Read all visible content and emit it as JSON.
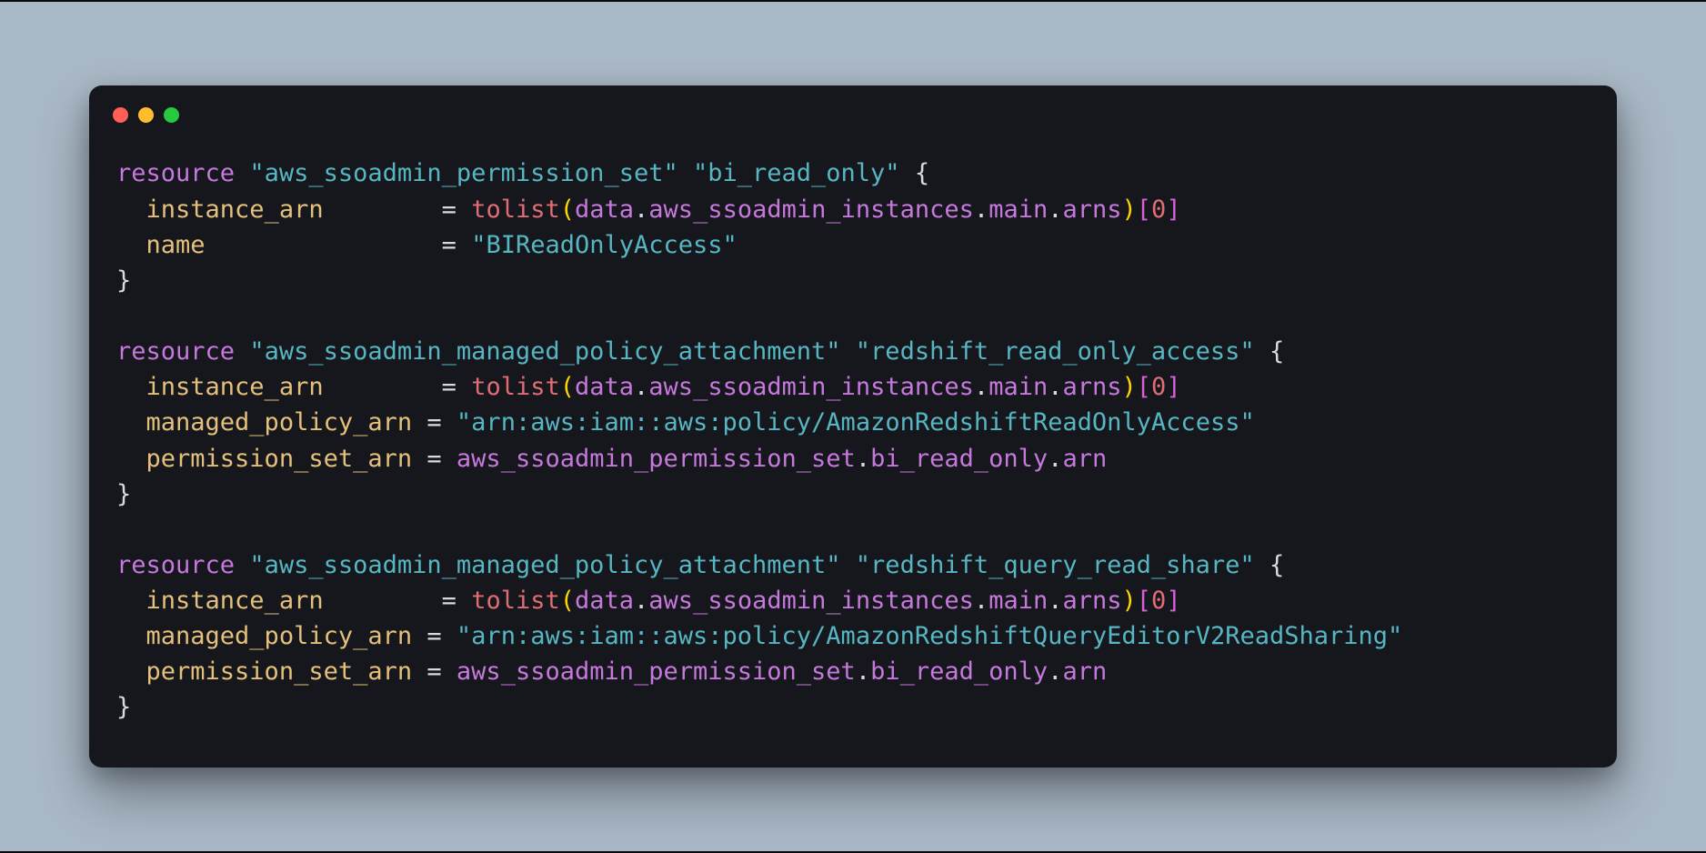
{
  "traffic_lights": {
    "red": "#ff5f56",
    "yellow": "#ffbd2e",
    "green": "#27c93f"
  },
  "code": {
    "block1": {
      "kw": "resource",
      "type": "\"aws_ssoadmin_permission_set\"",
      "name": "\"bi_read_only\"",
      "instance_arn_key": "instance_arn",
      "instance_arn_pad": "       ",
      "tolist": "tolist",
      "ref_data": "data",
      "ref_mod": "aws_ssoadmin_instances",
      "ref_inst": "main",
      "ref_attr": "arns",
      "idx": "0",
      "name_key": "name",
      "name_pad": "               ",
      "name_val": "\"BIReadOnlyAccess\""
    },
    "block2": {
      "kw": "resource",
      "type": "\"aws_ssoadmin_managed_policy_attachment\"",
      "name": "\"redshift_read_only_access\"",
      "instance_arn_key": "instance_arn",
      "instance_arn_pad": "       ",
      "tolist": "tolist",
      "ref_data": "data",
      "ref_mod": "aws_ssoadmin_instances",
      "ref_inst": "main",
      "ref_attr": "arns",
      "idx": "0",
      "managed_key": "managed_policy_arn",
      "managed_val": "\"arn:aws:iam::aws:policy/AmazonRedshiftReadOnlyAccess\"",
      "perm_key": "permission_set_arn",
      "perm_ref_a": "aws_ssoadmin_permission_set",
      "perm_ref_b": "bi_read_only",
      "perm_ref_c": "arn"
    },
    "block3": {
      "kw": "resource",
      "type": "\"aws_ssoadmin_managed_policy_attachment\"",
      "name": "\"redshift_query_read_share\"",
      "instance_arn_key": "instance_arn",
      "instance_arn_pad": "       ",
      "tolist": "tolist",
      "ref_data": "data",
      "ref_mod": "aws_ssoadmin_instances",
      "ref_inst": "main",
      "ref_attr": "arns",
      "idx": "0",
      "managed_key": "managed_policy_arn",
      "managed_val": "\"arn:aws:iam::aws:policy/AmazonRedshiftQueryEditorV2ReadSharing\"",
      "perm_key": "permission_set_arn",
      "perm_ref_a": "aws_ssoadmin_permission_set",
      "perm_ref_b": "bi_read_only",
      "perm_ref_c": "arn"
    }
  }
}
